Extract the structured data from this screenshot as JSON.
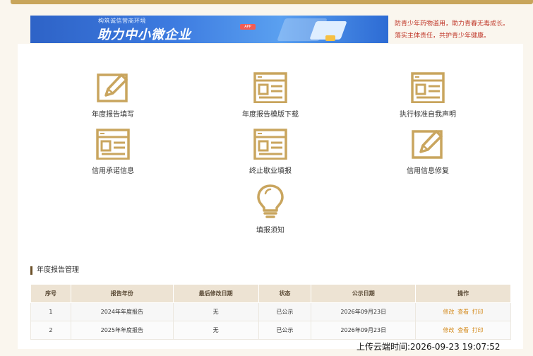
{
  "banner": {
    "small_text": "构筑诚信营商环境",
    "big_text": "助力中小微企业",
    "tag": "APP"
  },
  "notice": {
    "line1": "防青少年药物滥用，助力青春无毒成长。",
    "line2": "落实主体责任，共护青少年健康。"
  },
  "menu": [
    {
      "label": "年度报告填写",
      "icon": "edit-icon"
    },
    {
      "label": "年度报告模版下载",
      "icon": "form-icon"
    },
    {
      "label": "执行标准自我声明",
      "icon": "form-icon"
    },
    {
      "label": "信用承诺信息",
      "icon": "form-icon"
    },
    {
      "label": "终止歇业填报",
      "icon": "form-icon"
    },
    {
      "label": "信用信息修复",
      "icon": "edit-icon"
    },
    {
      "label": "填报须知",
      "icon": "lightbulb-icon"
    }
  ],
  "section_title": "年度报告管理",
  "table": {
    "headers": [
      "序号",
      "报告年份",
      "最后修改日期",
      "状态",
      "公示日期",
      "操作"
    ],
    "rows": [
      {
        "index": "1",
        "year": "2024年年度报告",
        "modified": "无",
        "status": "已公示",
        "publish_date": "2026年09月23日",
        "actions": [
          "修改",
          "查看",
          "打印"
        ]
      },
      {
        "index": "2",
        "year": "2025年年度报告",
        "modified": "无",
        "status": "已公示",
        "publish_date": "2026年09月23日",
        "actions": [
          "修改",
          "查看",
          "打印"
        ]
      }
    ]
  },
  "upload_time": "上传云端时间:2026-09-23 19:07:52",
  "colors": {
    "accent": "#c8a55b",
    "icon": "#c9a55e",
    "link": "#d48b1e",
    "notice": "#c0392b"
  }
}
